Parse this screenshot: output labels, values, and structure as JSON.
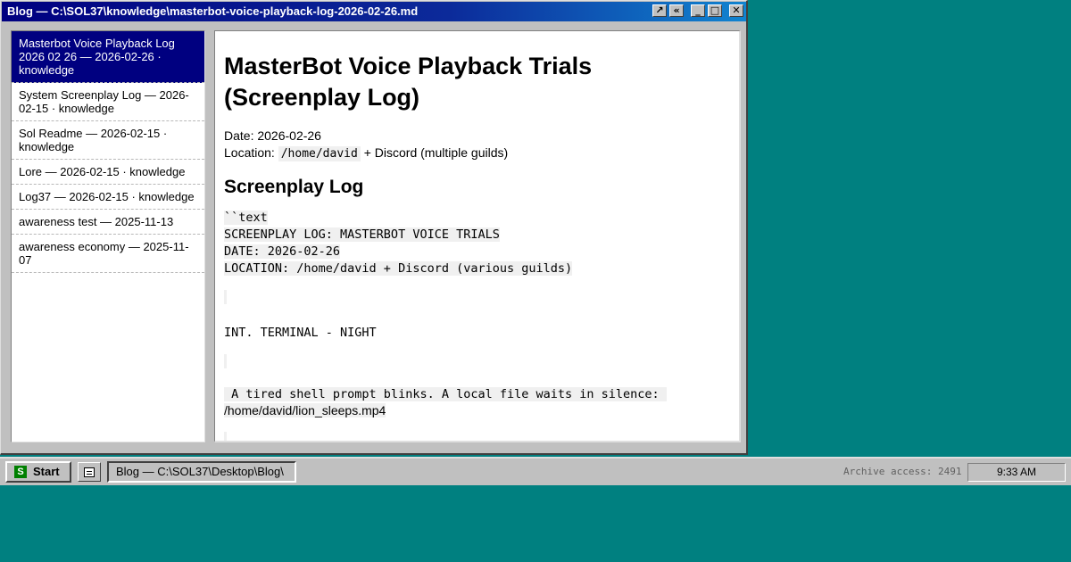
{
  "window": {
    "title": "Blog — C:\\SOL37\\knowledge\\masterbot-voice-playback-log-2026-02-26.md",
    "buttons": {
      "pin": "↗",
      "collapse": "«",
      "minimize": "_",
      "maximize": "□",
      "close": "✕"
    }
  },
  "sidebar": {
    "items": [
      {
        "label": "Masterbot Voice Playback Log 2026 02 26 — 2026-02-26 · knowledge",
        "active": true
      },
      {
        "label": "System Screenplay Log — 2026-02-15 · knowledge"
      },
      {
        "label": "Sol Readme — 2026-02-15 · knowledge"
      },
      {
        "label": "Lore — 2026-02-15 · knowledge"
      },
      {
        "label": "Log37 — 2026-02-15 · knowledge"
      },
      {
        "label": "awareness test — 2025-11-13"
      },
      {
        "label": "awareness economy — 2025-11-07"
      }
    ]
  },
  "article": {
    "title": "MasterBot Voice Playback Trials (Screenplay Log)",
    "date_line": "Date: 2026-02-26",
    "location_prefix": "Location:",
    "location_code": "/home/david",
    "location_suffix": "+ Discord (multiple guilds)",
    "section_heading": "Screenplay Log",
    "code_lines": [
      "``text",
      "SCREENPLAY LOG: MASTERBOT VOICE TRIALS",
      "DATE: 2026-02-26",
      "LOCATION: /home/david + Discord (various guilds)"
    ],
    "scene_heading": "INT. TERMINAL - NIGHT",
    "paragraph_mono": " A tired shell prompt blinks. A local file waits in silence: ",
    "paragraph_path": "/home/david/lion_sleeps.mp4"
  },
  "taskbar": {
    "start_label": "Start",
    "start_logo": "S",
    "task_label": "Blog — C:\\SOL37\\Desktop\\Blog\\",
    "archive": "Archive access: 2491",
    "clock": "9:33 AM"
  },
  "colors": {
    "desktop": "#008080",
    "titlebar": "#000080",
    "selection": "#000080",
    "start_logo": "#008000"
  }
}
